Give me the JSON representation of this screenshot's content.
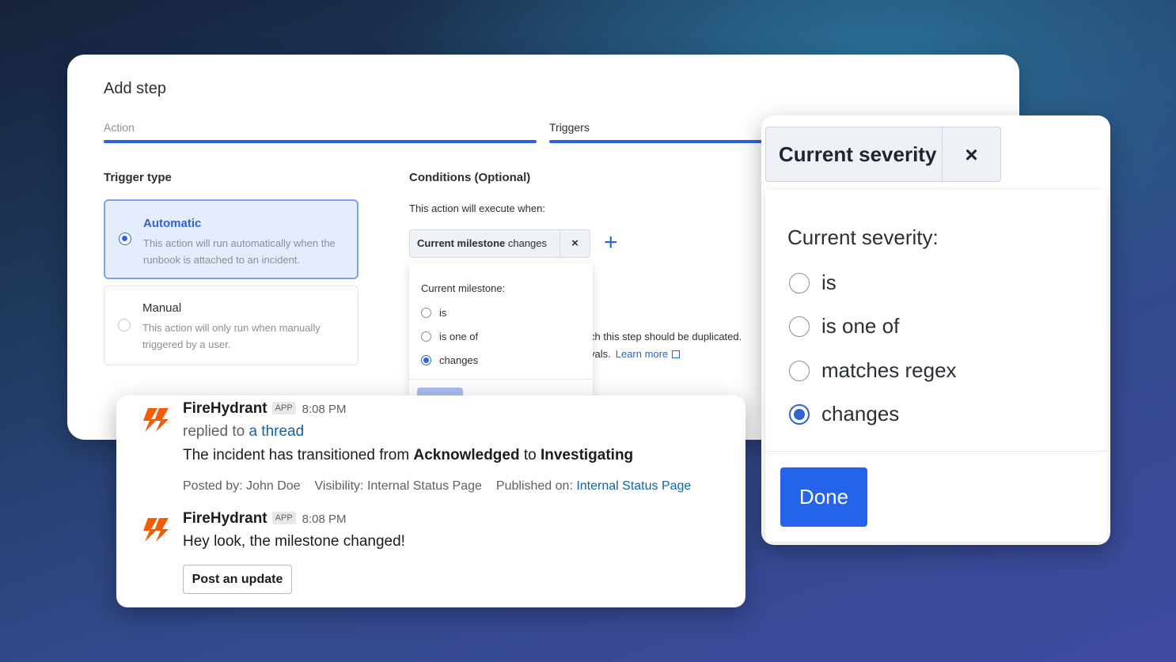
{
  "add_step": {
    "title": "Add step",
    "tabs": [
      {
        "label": "Action"
      },
      {
        "label": "Triggers"
      }
    ],
    "trigger_type_heading": "Trigger type",
    "trigger_options": [
      {
        "title": "Automatic",
        "desc": "This action will run automatically when the runbook is attached to an incident.",
        "selected": true
      },
      {
        "title": "Manual",
        "desc": "This action will only run when manually triggered by a user.",
        "selected": false
      }
    ],
    "conditions_heading": "Conditions (Optional)",
    "execute_when": "This action will execute when:",
    "chip": {
      "bold": "Current milestone",
      "rest": " changes",
      "close": "×"
    },
    "plus": "+",
    "milestone_dropdown": {
      "title": "Current milestone:",
      "options": [
        {
          "label": "is",
          "selected": false
        },
        {
          "label": "is one of",
          "selected": false
        },
        {
          "label": "changes",
          "selected": true
        }
      ]
    },
    "duplicate_text_1": "ch this step should be duplicated.",
    "duplicate_text_2": "vals.",
    "learn_more": "Learn more"
  },
  "severity": {
    "chip_label": "Current severity",
    "chip_close": "×",
    "dropdown_title": "Current severity:",
    "options": [
      {
        "label": "is",
        "selected": false
      },
      {
        "label": "is one of",
        "selected": false
      },
      {
        "label": "matches regex",
        "selected": false
      },
      {
        "label": "changes",
        "selected": true
      }
    ],
    "done_label": "Done"
  },
  "slack": {
    "messages": [
      {
        "sender": "FireHydrant",
        "badge": "APP",
        "time": "8:08 PM",
        "replied_prefix": "replied to ",
        "thread_link": "a thread",
        "body_prefix": "The incident has transitioned from ",
        "body_from": "Acknowledged",
        "body_mid": " to ",
        "body_to": "Investigating",
        "posted_by": "Posted by: John Doe",
        "visibility": "Visibility: Internal Status Page",
        "published_prefix": "Published on: ",
        "published_link": "Internal Status Page"
      },
      {
        "sender": "FireHydrant",
        "badge": "APP",
        "time": "8:08 PM",
        "body": "Hey look, the milestone changed!",
        "button": "Post an update"
      }
    ]
  },
  "colors": {
    "accent": "#2f63d8",
    "done_button": "#2563eb",
    "link": "#1264a3",
    "logo": "#f25c05"
  }
}
